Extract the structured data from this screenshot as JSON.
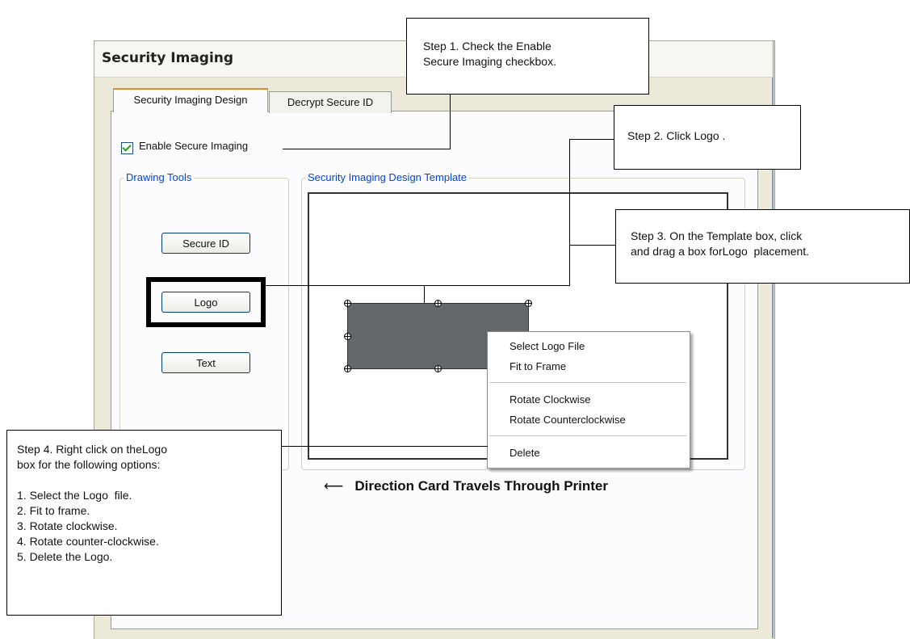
{
  "window": {
    "title": "Security Imaging"
  },
  "tabs": [
    {
      "label": "Security Imaging Design",
      "active": true
    },
    {
      "label": "Decrypt Secure ID",
      "active": false
    }
  ],
  "enable_checkbox": {
    "label": "Enable Secure Imaging",
    "checked": true
  },
  "drawing_tools": {
    "title": "Drawing Tools",
    "buttons": [
      "Secure ID",
      "Logo",
      "Text"
    ]
  },
  "template": {
    "title": "Security Imaging Design Template"
  },
  "context_menu": {
    "items": [
      "Select Logo File",
      "Fit to Frame",
      "Rotate Clockwise",
      "Rotate Counterclockwise",
      "Delete"
    ]
  },
  "direction_label": "Direction Card Travels Through Printer",
  "direction_arrow": "⟵",
  "callouts": {
    "step1": [
      "Step 1. Check the Enable",
      "Secure Imaging checkbox."
    ],
    "step2": [
      "Step 2. Click Logo ."
    ],
    "step3": [
      "Step 3. On the Template box, click",
      "and drag a box forLogo  placement."
    ],
    "step4": [
      "Step 4. Right click on theLogo",
      "box for the following options:",
      "",
      "1. Select the Logo  file.",
      "2. Fit to frame.",
      "3. Rotate clockwise.",
      "4. Rotate counter-clockwise.",
      "5. Delete the Logo."
    ]
  },
  "colors": {
    "window_bg": "#ECE9D8",
    "tab_accent": "#E68B2C",
    "group_title": "#0046D5",
    "logo_box": "#63666B",
    "checkmark": "#21A121"
  }
}
